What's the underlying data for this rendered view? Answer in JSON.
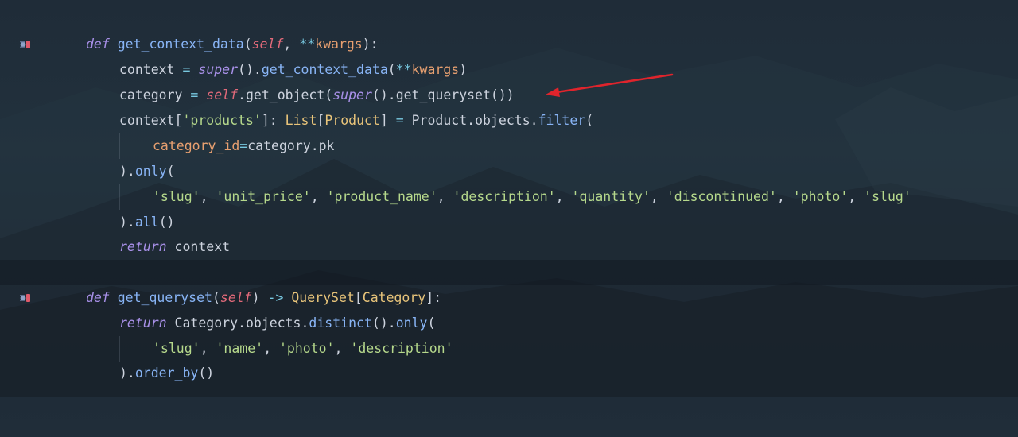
{
  "theme": {
    "keyword": "#a890e8",
    "function": "#88b4f5",
    "self": "#e26a7a",
    "operator": "#78c8e0",
    "string": "#b6d98c",
    "parameter": "#e8a070",
    "type": "#e8c47a",
    "annotation_arrow": "#e0242c"
  },
  "gutter": {
    "icon": "override-method-icon"
  },
  "code": {
    "l1": {
      "kw": "def",
      "fn": "get_context_data",
      "p1": "(",
      "self": "self",
      "p2": ", ",
      "op": "**",
      "param": "kwargs",
      "p3": "):"
    },
    "l2": {
      "a": "context ",
      "eq": "=",
      "sp": " ",
      "super": "super",
      "b": "().",
      "fn": "get_context_data",
      "c": "(",
      "op": "**",
      "param": "kwargs",
      "d": ")"
    },
    "l3": {
      "a": "category ",
      "eq": "=",
      "sp": " ",
      "self": "self",
      "b": ".get_object(",
      "super": "super",
      "c": "().get_queryset())"
    },
    "l4": {
      "a": "context[",
      "s1": "'products'",
      "b": "]: ",
      "t1": "List",
      "c": "[",
      "t2": "Product",
      "d": "] ",
      "eq": "=",
      "e": " Product.objects.",
      "fn": "filter",
      "f": "("
    },
    "l5": {
      "param": "category_id",
      "eq": "=",
      "a": "category.pk"
    },
    "l6": {
      "a": ").",
      "fn": "only",
      "b": "("
    },
    "l7": {
      "s1": "'slug'",
      "c1": ", ",
      "s2": "'unit_price'",
      "c2": ", ",
      "s3": "'product_name'",
      "c3": ", ",
      "s4": "'description'",
      "c4": ", ",
      "s5": "'quantity'",
      "c5": ", ",
      "s6": "'discontinued'",
      "c6": ", ",
      "s7": "'photo'",
      "c7": ", ",
      "s8": "'slug'"
    },
    "l8": {
      "a": ").",
      "fn": "all",
      "b": "()"
    },
    "l9": {
      "kw": "return",
      "a": " context"
    },
    "l11": {
      "kw": "def",
      "fn": "get_queryset",
      "p1": "(",
      "self": "self",
      "p2": ") ",
      "op": "->",
      "sp": " ",
      "t1": "QuerySet",
      "c": "[",
      "t2": "Category",
      "d": "]:"
    },
    "l12": {
      "kw": "return",
      "a": " Category.objects.",
      "fn": "distinct",
      "b": "().",
      "fn2": "only",
      "c": "("
    },
    "l13": {
      "s1": "'slug'",
      "c1": ", ",
      "s2": "'name'",
      "c2": ", ",
      "s3": "'photo'",
      "c3": ", ",
      "s4": "'description'"
    },
    "l14": {
      "a": ").",
      "fn": "order_by",
      "b": "()"
    }
  }
}
